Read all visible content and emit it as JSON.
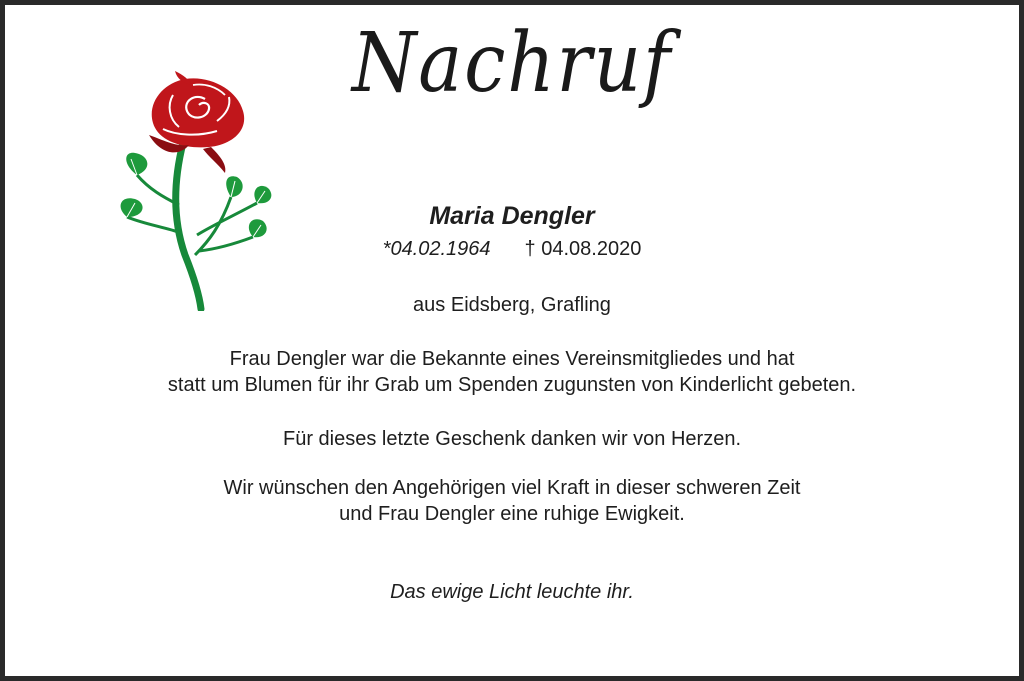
{
  "notice": {
    "title": "Nachruf",
    "name": "Maria Dengler",
    "birth": "*04.02.1964",
    "death": "† 04.08.2020",
    "origin": "aus Eidsberg, Grafling",
    "paragraph1_line1": "Frau Dengler war die Bekannte eines Vereinsmitgliedes und hat",
    "paragraph1_line2": "statt um Blumen für ihr Grab um Spenden zugunsten von Kinderlicht gebeten.",
    "paragraph2": "Für dieses letzte Geschenk danken wir von Herzen.",
    "paragraph3_line1": "Wir wünschen den Angehörigen viel Kraft in dieser schweren Zeit",
    "paragraph3_line2": "und Frau Dengler eine ruhige Ewigkeit.",
    "closing": "Das ewige Licht leuchte ihr."
  },
  "decoration": {
    "icon": "rose-icon",
    "petal_color": "#c0161b",
    "petal_dark_color": "#8a0d12",
    "leaf_color": "#1e9a3c",
    "stem_color": "#17893a",
    "border_color": "#2a2a2a"
  }
}
